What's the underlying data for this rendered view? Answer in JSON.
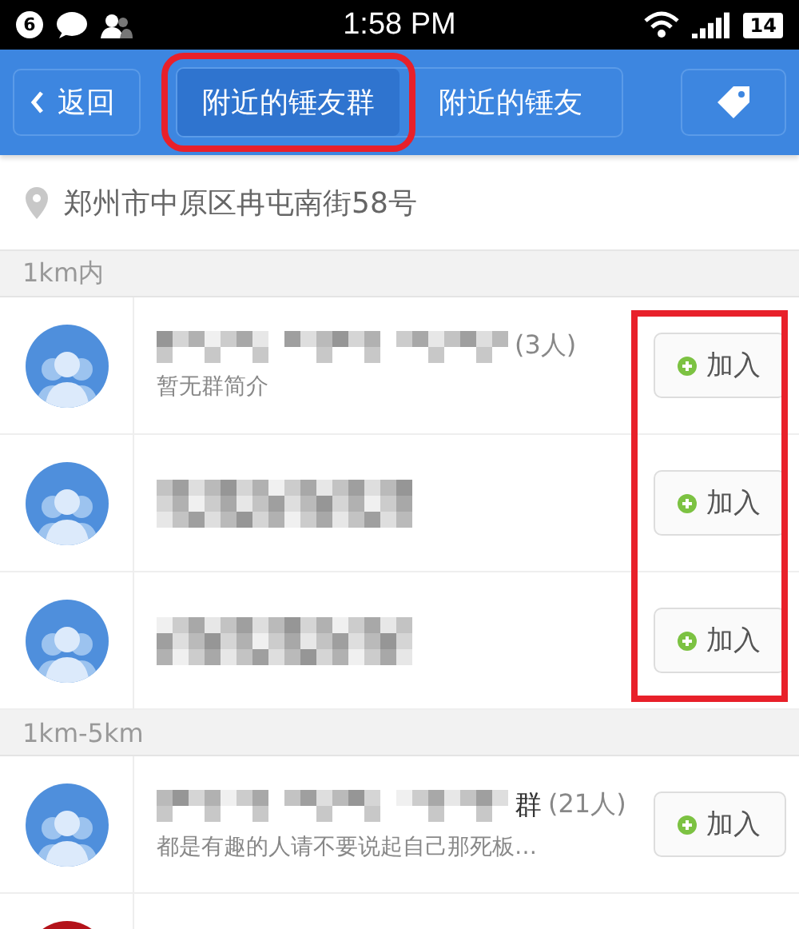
{
  "status_bar": {
    "notification_count": "6",
    "time": "1:58 PM",
    "battery": "14"
  },
  "nav": {
    "back": "返回",
    "tabs": [
      {
        "label": "附近的锤友群",
        "selected": true,
        "highlighted": true
      },
      {
        "label": "附近的锤友",
        "selected": false,
        "highlighted": false
      }
    ]
  },
  "location": "郑州市中原区冉屯南街58号",
  "sections": [
    {
      "title": "1km内",
      "join_highlighted": true,
      "groups": [
        {
          "kind": "inline",
          "color": "#4f8fdc",
          "count": "(3人)",
          "intro": "暂无群简介",
          "join": "加入"
        },
        {
          "kind": "stacked",
          "color": "#4f8fdc",
          "join": "加入"
        },
        {
          "kind": "stacked",
          "color": "#4f8fdc",
          "join": "加入"
        }
      ]
    },
    {
      "title": "1km-5km",
      "groups": [
        {
          "kind": "inline",
          "color": "#4f8fdc",
          "name_suffix": "群",
          "count": "(21人)",
          "intro": "都是有趣的人请不要说起自己那死板…",
          "join": "加入"
        },
        {
          "kind": "partial",
          "color": "#b4131a"
        }
      ]
    }
  ]
}
